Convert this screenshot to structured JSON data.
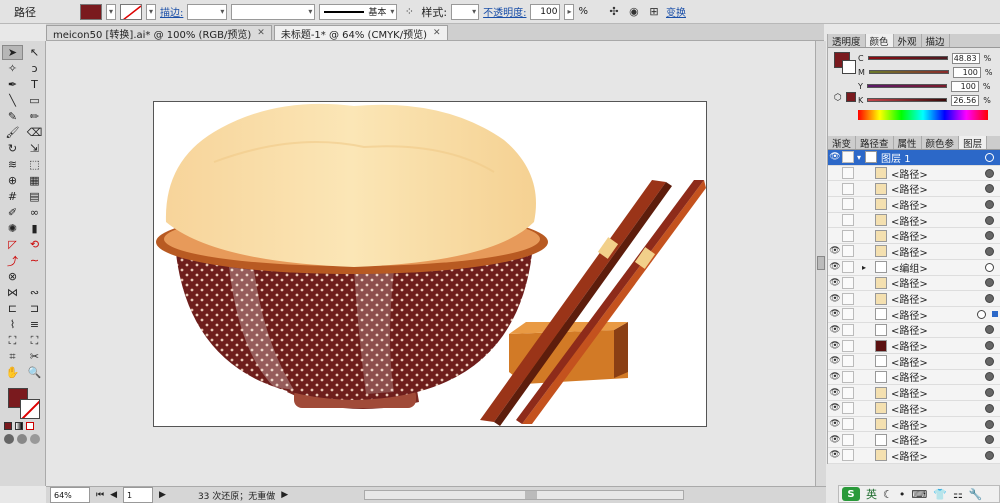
{
  "control_bar": {
    "object_label": "路径",
    "stroke_link": "描边:",
    "brush_label": "基本",
    "style_label": "样式:",
    "opacity_link": "不透明度:",
    "opacity_value": "100",
    "percent": "%",
    "transform_link": "变换",
    "fill_color": "#7a1a1e"
  },
  "tabs": [
    {
      "label": "meicon50 [转换].ai* @ 100% (RGB/预览)"
    },
    {
      "label": "未标题-1* @ 64% (CMYK/预览)"
    }
  ],
  "color_panel": {
    "tabs": [
      "透明度",
      "颜色",
      "外观",
      "描边"
    ],
    "channels": [
      {
        "name": "C",
        "value": "48.83"
      },
      {
        "name": "M",
        "value": "100"
      },
      {
        "name": "Y",
        "value": "100"
      },
      {
        "name": "K",
        "value": "26.56"
      }
    ]
  },
  "layers_panel": {
    "tabs": [
      "渐变",
      "路径查",
      "属性",
      "颜色参",
      "图层"
    ],
    "layer_name": "图层 1",
    "items": [
      {
        "label": "<路径>"
      },
      {
        "label": "<路径>"
      },
      {
        "label": "<路径>"
      },
      {
        "label": "<路径>"
      },
      {
        "label": "<路径>"
      },
      {
        "label": "<路径>"
      },
      {
        "label": "<编组>"
      },
      {
        "label": "<路径>"
      },
      {
        "label": "<路径>"
      },
      {
        "label": "<路径>"
      },
      {
        "label": "<路径>"
      },
      {
        "label": "<路径>"
      },
      {
        "label": "<路径>"
      },
      {
        "label": "<路径>"
      },
      {
        "label": "<路径>"
      },
      {
        "label": "<路径>"
      },
      {
        "label": "<路径>"
      },
      {
        "label": "<路径>"
      },
      {
        "label": "<路径>"
      },
      {
        "label": "<路径>"
      }
    ]
  },
  "status_bar": {
    "zoom": "64%",
    "page": "1",
    "message": "33 次还原；无重做"
  },
  "ime": {
    "lang": "英"
  }
}
